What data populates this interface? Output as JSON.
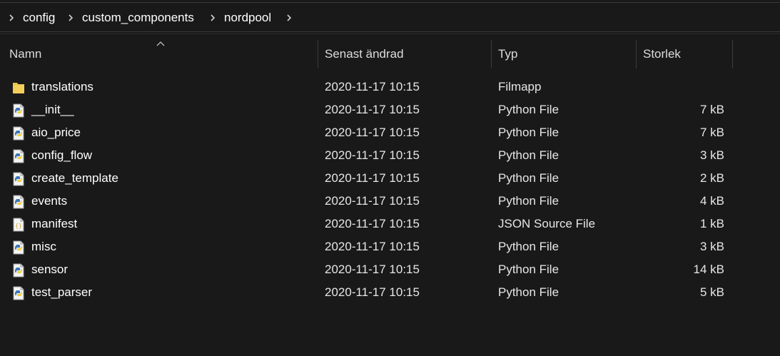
{
  "breadcrumb": {
    "items": [
      "config",
      "custom_components",
      "nordpool"
    ]
  },
  "columns": {
    "name": "Namn",
    "modified": "Senast ändrad",
    "type": "Typ",
    "size": "Storlek"
  },
  "files": [
    {
      "name": "translations",
      "modified": "2020-11-17 10:15",
      "type": "Filmapp",
      "size": "",
      "icon": "folder-icon"
    },
    {
      "name": "__init__",
      "modified": "2020-11-17 10:15",
      "type": "Python File",
      "size": "7 kB",
      "icon": "python-file-icon"
    },
    {
      "name": "aio_price",
      "modified": "2020-11-17 10:15",
      "type": "Python File",
      "size": "7 kB",
      "icon": "python-file-icon"
    },
    {
      "name": "config_flow",
      "modified": "2020-11-17 10:15",
      "type": "Python File",
      "size": "3 kB",
      "icon": "python-file-icon"
    },
    {
      "name": "create_template",
      "modified": "2020-11-17 10:15",
      "type": "Python File",
      "size": "2 kB",
      "icon": "python-file-icon"
    },
    {
      "name": "events",
      "modified": "2020-11-17 10:15",
      "type": "Python File",
      "size": "4 kB",
      "icon": "python-file-icon"
    },
    {
      "name": "manifest",
      "modified": "2020-11-17 10:15",
      "type": "JSON Source File",
      "size": "1 kB",
      "icon": "json-file-icon"
    },
    {
      "name": "misc",
      "modified": "2020-11-17 10:15",
      "type": "Python File",
      "size": "3 kB",
      "icon": "python-file-icon"
    },
    {
      "name": "sensor",
      "modified": "2020-11-17 10:15",
      "type": "Python File",
      "size": "14 kB",
      "icon": "python-file-icon"
    },
    {
      "name": "test_parser",
      "modified": "2020-11-17 10:15",
      "type": "Python File",
      "size": "5 kB",
      "icon": "python-file-icon"
    }
  ],
  "colors": {
    "background": "#191919",
    "text": "#ffffff",
    "folder": "#e8c24a",
    "python_blue": "#3b76b8",
    "python_yellow": "#f2cf3a"
  }
}
